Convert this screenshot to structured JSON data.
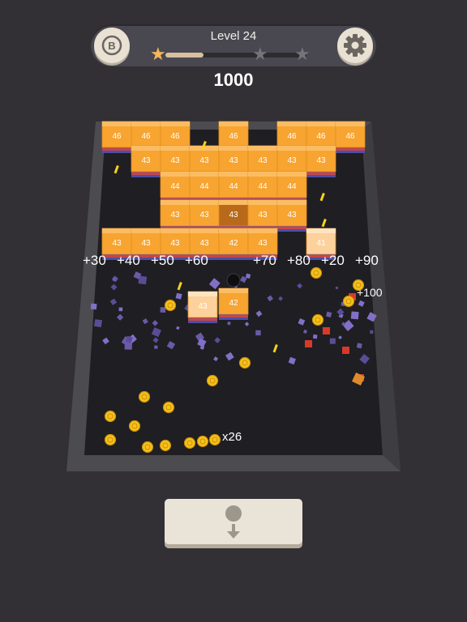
{
  "hud": {
    "level_label": "Level 24",
    "score": "1000",
    "progress": 0.27,
    "stars_total": 3,
    "stars_earned": 1,
    "left_button_glyph": "B",
    "left_button_icon": "coin-shop-icon",
    "settings_icon": "gear-icon"
  },
  "board": {
    "block_rows": [
      [
        "46",
        "46",
        "46",
        "",
        "46",
        "",
        "46",
        "46",
        "46"
      ],
      [
        "43",
        "43",
        "43",
        "43",
        "43",
        "43",
        "43",
        ""
      ],
      [
        "",
        "44",
        "44",
        "44",
        "44",
        "44",
        ""
      ],
      [
        "",
        "43",
        "43",
        "43",
        "43",
        "43",
        ""
      ],
      [
        "43",
        "43",
        "43",
        "43",
        "42",
        "43",
        "41"
      ],
      [
        "43",
        "42"
      ]
    ],
    "row_labels": {
      "r0": [
        "46",
        "46",
        "46",
        "46",
        "46",
        "46",
        "46"
      ],
      "r1": [
        "43",
        "43",
        "43",
        "43",
        "43",
        "43",
        "43"
      ],
      "r2": [
        "44",
        "44",
        "44",
        "44",
        "44"
      ],
      "r3": [
        "43",
        "43",
        "43",
        "43",
        "43"
      ],
      "r4": [
        "43",
        "43",
        "43",
        "43",
        "42",
        "43",
        "41"
      ],
      "loose": [
        "43",
        "42"
      ]
    },
    "points_popups": [
      "+30",
      "+40",
      "+50",
      "+60",
      "+70",
      "+80",
      "+20",
      "+90",
      "+100"
    ],
    "ball_count": "x26"
  },
  "drop_button": {
    "icon": "drop-ball-arrow-icon"
  },
  "colors": {
    "block_top": "#fbb960",
    "block_front": "#f49a1e",
    "block_light": "#fcd19a",
    "coin": "#f7c21b",
    "board_wall": "#4c4b50",
    "board_floor": "#1e1d21"
  }
}
